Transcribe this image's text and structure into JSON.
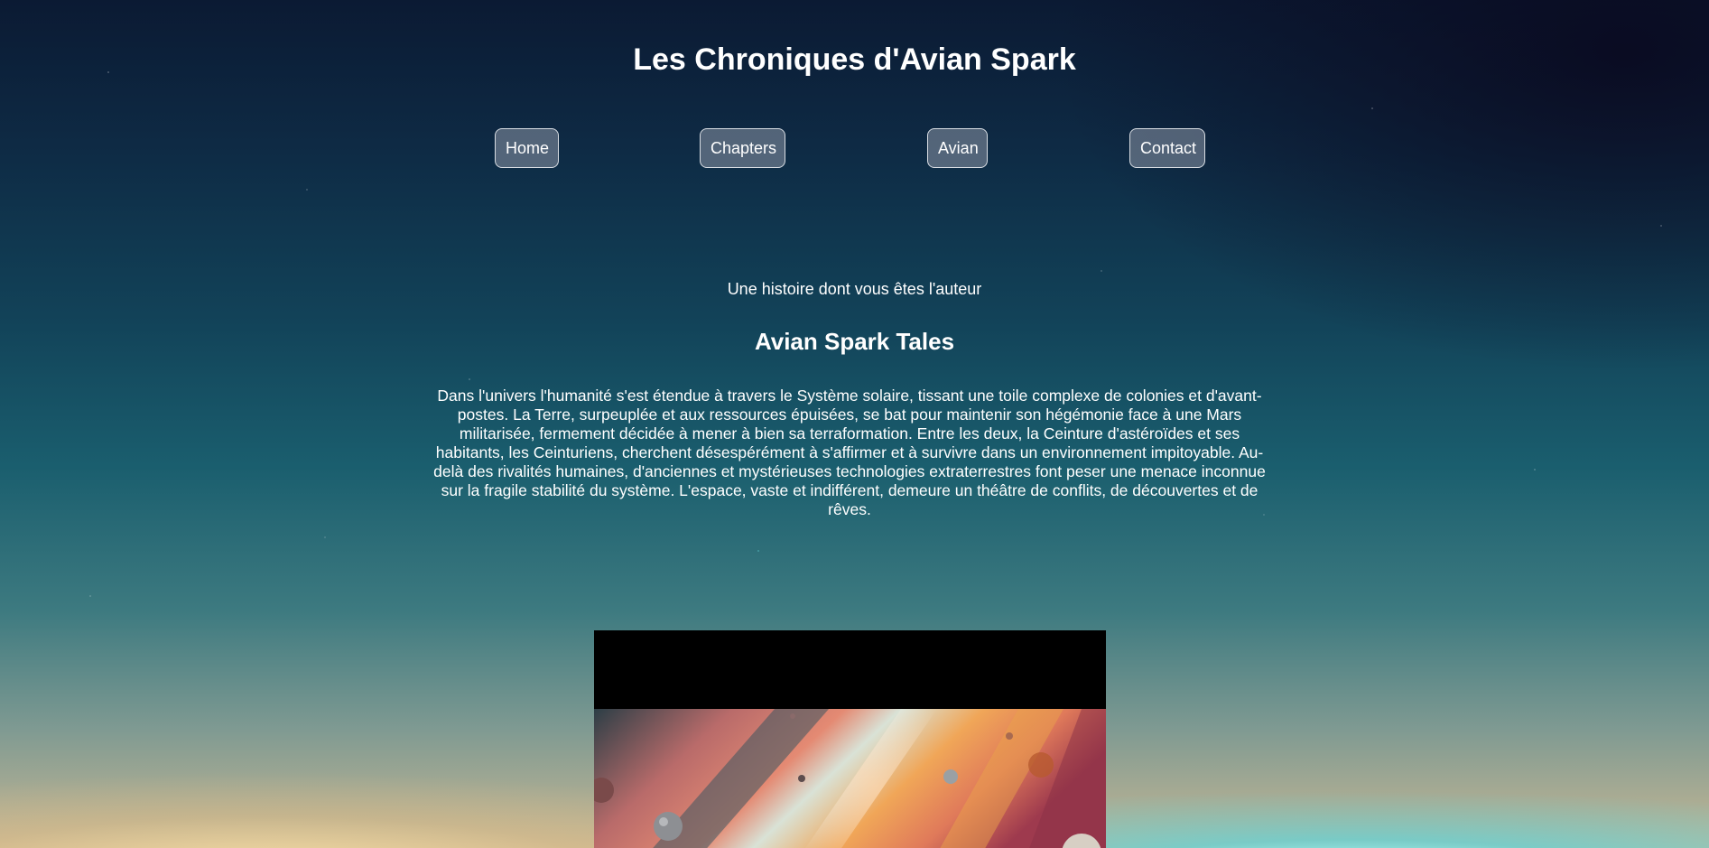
{
  "header": {
    "title": "Les Chroniques d'Avian Spark"
  },
  "nav": {
    "items": [
      {
        "label": "Home"
      },
      {
        "label": "Chapters"
      },
      {
        "label": "Avian"
      },
      {
        "label": "Contact"
      }
    ]
  },
  "main": {
    "subtitle": "Une histoire dont vous êtes l'auteur",
    "section_title": "Avian Spark Tales",
    "intro": "Dans l'univers l'humanité s'est étendue à travers le Système solaire, tissant une toile complexe de colonies et d'avant-postes. La Terre, surpeuplée et aux ressources épuisées, se bat pour maintenir son hégémonie face à une Mars militarisée, fermement décidée à mener à bien sa terraformation. Entre les deux, la Ceinture d'astéroïdes et ses habitants, les Ceinturiens, cherchent désespérément à s'affirmer et à survivre dans un environnement impitoyable. Au-delà des rivalités humaines, d'anciennes et mystérieuses technologies extraterrestres font peser une menace inconnue sur la fragile stabilité du système. L'espace, vaste et indifférent, demeure un théâtre de conflits, de découvertes et de rêves."
  },
  "colors": {
    "nav_border": "#d8dde3",
    "text": "#ffffff",
    "media_background": "#000000"
  }
}
